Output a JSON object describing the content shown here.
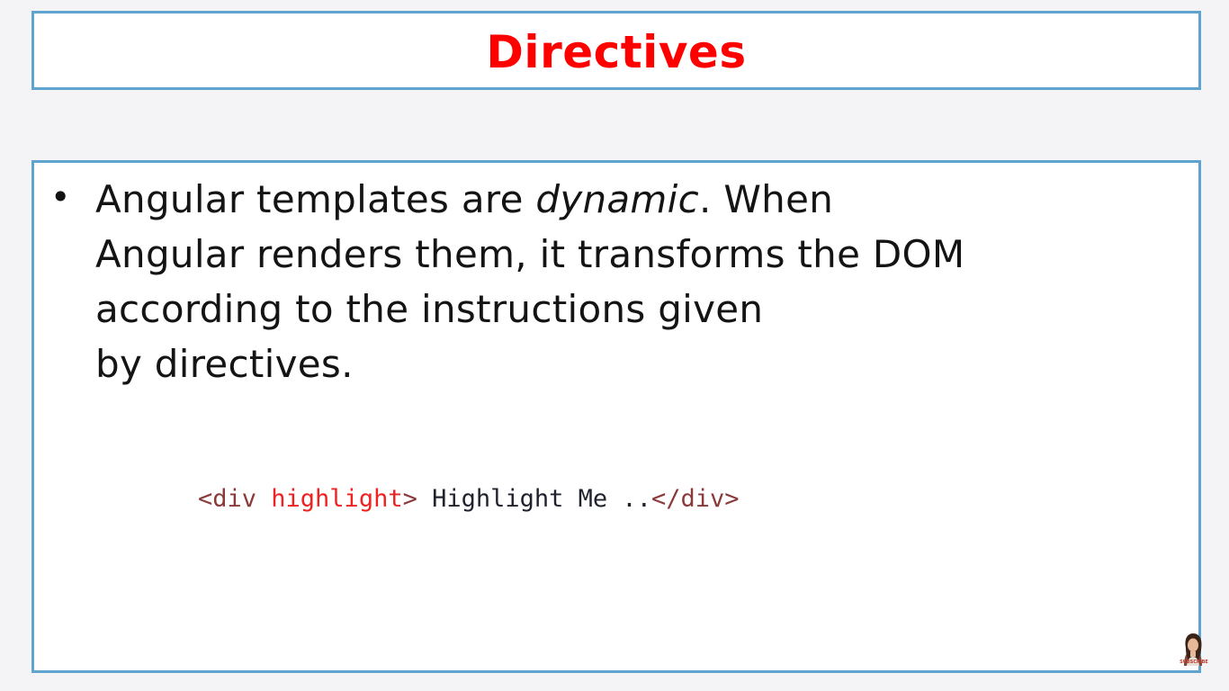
{
  "slide": {
    "title": "Directives",
    "title_color": "#ff0000",
    "border_color": "#5fa3cf",
    "bullet": "•",
    "paragraph": {
      "line1_pre": "Angular templates are ",
      "line1_em": "dynamic",
      "line1_post": ". When",
      "line2": "Angular renders them, it transforms the DOM",
      "line3": "according to the instructions given",
      "line4": "by directives."
    },
    "code": {
      "open_tag_start": "<div ",
      "attribute": "highlight",
      "open_tag_end": ">",
      "text": " Highlight Me ..",
      "close_tag": "</div>"
    }
  },
  "overlay": {
    "avatar_icon": "subscriber-avatar-icon",
    "subscribe_label": "SUBSCRIBE"
  }
}
